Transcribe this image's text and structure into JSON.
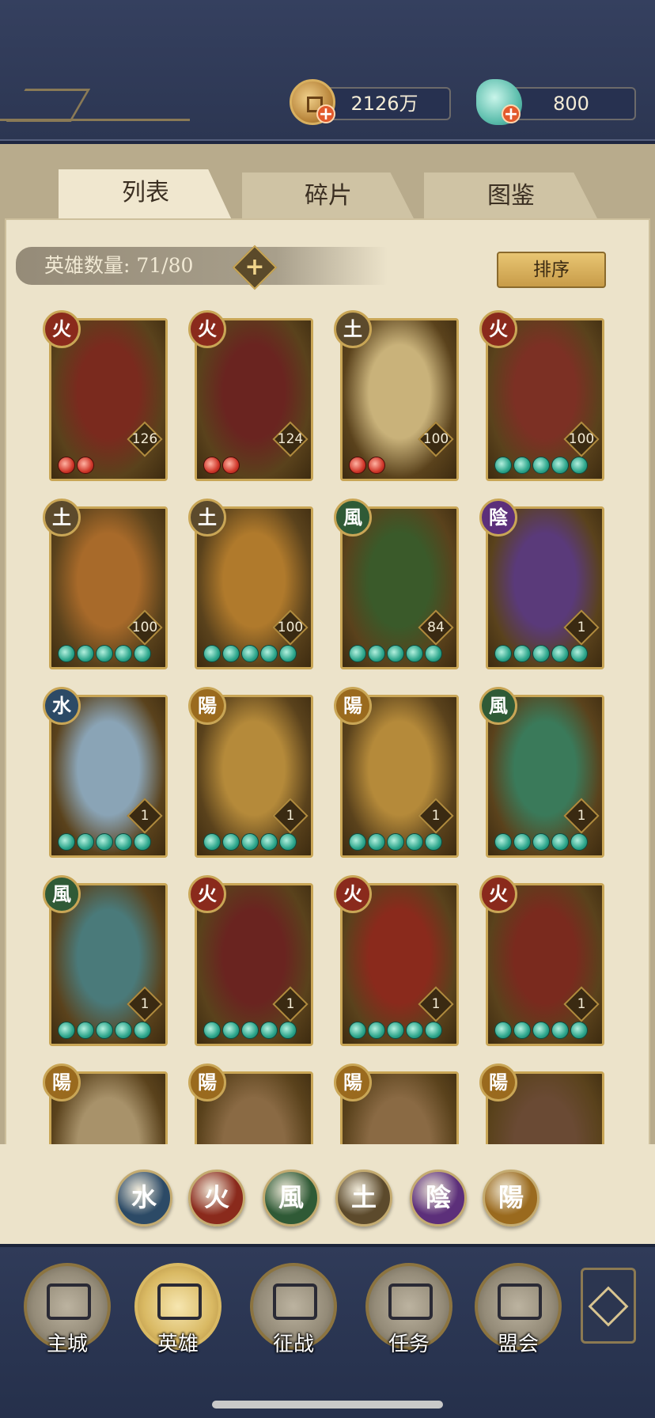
{
  "resources": {
    "coins": "2126万",
    "jade": "800"
  },
  "tabs": [
    {
      "label": "列表",
      "active": true
    },
    {
      "label": "碎片",
      "active": false
    },
    {
      "label": "图鉴",
      "active": false
    }
  ],
  "hero_count": {
    "label": "英雄数量: 71/80",
    "current": 71,
    "max": 80
  },
  "sort_label": "排序",
  "element_colors": {
    "fire": "#8a2a1c",
    "earth": "#5c4a2c",
    "wind": "#2f5a36",
    "yin": "#5c2f7a",
    "yang": "#9a6a1e",
    "water": "#2c4a66"
  },
  "heroes": [
    {
      "element": "fire",
      "glyph": "火",
      "level": "126",
      "stars": 2,
      "star_color": "red",
      "palette": "#7a2a1e"
    },
    {
      "element": "fire",
      "glyph": "火",
      "level": "124",
      "stars": 2,
      "star_color": "red",
      "palette": "#6a2420"
    },
    {
      "element": "earth",
      "glyph": "土",
      "level": "100",
      "stars": 2,
      "star_color": "red",
      "palette": "#c9b27a"
    },
    {
      "element": "fire",
      "glyph": "火",
      "level": "100",
      "stars": 5,
      "star_color": "jade",
      "palette": "#7c3024"
    },
    {
      "element": "earth",
      "glyph": "土",
      "level": "100",
      "stars": 5,
      "star_color": "jade",
      "palette": "#a86a2a"
    },
    {
      "element": "earth",
      "glyph": "土",
      "level": "100",
      "stars": 5,
      "star_color": "jade",
      "palette": "#b07a2c"
    },
    {
      "element": "wind",
      "glyph": "風",
      "level": "84",
      "stars": 5,
      "star_color": "jade",
      "palette": "#3a5a2a"
    },
    {
      "element": "yin",
      "glyph": "陰",
      "level": "1",
      "stars": 5,
      "star_color": "jade",
      "palette": "#5a3a7a"
    },
    {
      "element": "water",
      "glyph": "水",
      "level": "1",
      "stars": 5,
      "star_color": "jade",
      "palette": "#8aa4b6"
    },
    {
      "element": "yang",
      "glyph": "陽",
      "level": "1",
      "stars": 5,
      "star_color": "jade",
      "palette": "#b58a3a"
    },
    {
      "element": "yang",
      "glyph": "陽",
      "level": "1",
      "stars": 5,
      "star_color": "jade",
      "palette": "#b58a3a"
    },
    {
      "element": "wind",
      "glyph": "風",
      "level": "1",
      "stars": 5,
      "star_color": "jade",
      "palette": "#3a7a5a"
    },
    {
      "element": "wind",
      "glyph": "風",
      "level": "1",
      "stars": 5,
      "star_color": "jade",
      "palette": "#4a7a7a"
    },
    {
      "element": "fire",
      "glyph": "火",
      "level": "1",
      "stars": 5,
      "star_color": "jade",
      "palette": "#6a2420"
    },
    {
      "element": "fire",
      "glyph": "火",
      "level": "1",
      "stars": 5,
      "star_color": "jade",
      "palette": "#8a2a1c"
    },
    {
      "element": "fire",
      "glyph": "火",
      "level": "1",
      "stars": 5,
      "star_color": "jade",
      "palette": "#7a2a1e"
    },
    {
      "element": "yang",
      "glyph": "陽",
      "level": "",
      "stars": 0,
      "star_color": "jade",
      "palette": "#a8926a"
    },
    {
      "element": "yang",
      "glyph": "陽",
      "level": "",
      "stars": 0,
      "star_color": "jade",
      "palette": "#8a6a44"
    },
    {
      "element": "yang",
      "glyph": "陽",
      "level": "",
      "stars": 0,
      "star_color": "jade",
      "palette": "#8a6a44"
    },
    {
      "element": "yang",
      "glyph": "陽",
      "level": "",
      "stars": 0,
      "star_color": "jade",
      "palette": "#6a4a34"
    }
  ],
  "element_filters": [
    {
      "element": "water",
      "glyph": "水"
    },
    {
      "element": "fire",
      "glyph": "火"
    },
    {
      "element": "wind",
      "glyph": "風"
    },
    {
      "element": "earth",
      "glyph": "土"
    },
    {
      "element": "yin",
      "glyph": "陰"
    },
    {
      "element": "yang",
      "glyph": "陽"
    }
  ],
  "nav": [
    {
      "label": "主城",
      "active": false,
      "icon": "city-gate-icon"
    },
    {
      "label": "英雄",
      "active": true,
      "icon": "hero-portrait-icon"
    },
    {
      "label": "征战",
      "active": false,
      "icon": "battle-flag-icon"
    },
    {
      "label": "任务",
      "active": false,
      "icon": "scroll-icon"
    },
    {
      "label": "盟会",
      "active": false,
      "icon": "guild-banner-icon"
    }
  ],
  "more_icon": "flower-menu-icon"
}
